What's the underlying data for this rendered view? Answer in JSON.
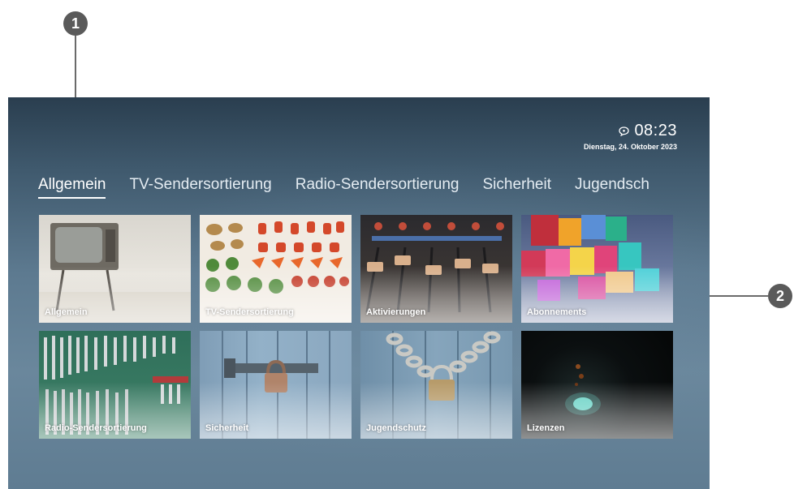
{
  "callouts": [
    "1",
    "2"
  ],
  "status": {
    "time": "08:23",
    "date": "Dienstag, 24. Oktober 2023",
    "message_icon": "message-icon"
  },
  "tabs": [
    {
      "label": "Allgemein",
      "active": true
    },
    {
      "label": "TV-Sendersortierung",
      "active": false
    },
    {
      "label": "Radio-Sendersortierung",
      "active": false
    },
    {
      "label": "Sicherheit",
      "active": false
    },
    {
      "label": "Jugendsch",
      "active": false
    }
  ],
  "tiles": [
    {
      "label": "Allgemein",
      "image": "retro-tv"
    },
    {
      "label": "TV-Sendersortierung",
      "image": "sorted-vegetables"
    },
    {
      "label": "Aktivierungen",
      "image": "mixing-console"
    },
    {
      "label": "Abonnements",
      "image": "colored-blocks"
    },
    {
      "label": "Radio-Sendersortierung",
      "image": "wrench-set"
    },
    {
      "label": "Sicherheit",
      "image": "door-padlock"
    },
    {
      "label": "Jugendschutz",
      "image": "chain-padlock"
    },
    {
      "label": "Lizenzen",
      "image": "dark-light"
    }
  ]
}
